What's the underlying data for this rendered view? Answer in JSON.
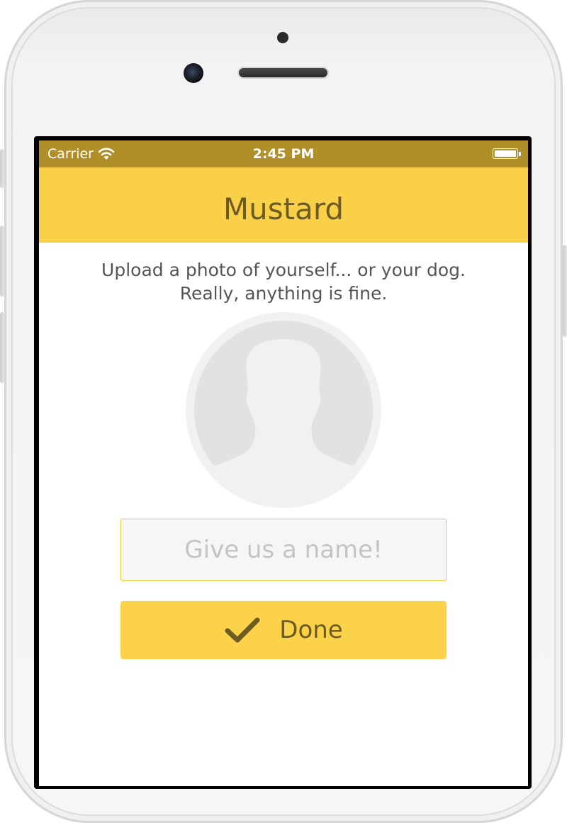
{
  "status_bar": {
    "carrier": "Carrier",
    "time": "2:45 PM",
    "wifi_icon": "wifi-icon",
    "battery_icon": "battery-icon",
    "battery_level": 1.0
  },
  "nav_bar": {
    "title": "Mustard"
  },
  "main": {
    "instructions": "Upload a photo of yourself... or your dog. Really, anything is fine.",
    "avatar_icon": "person-silhouette-icon",
    "name_field": {
      "placeholder": "Give us a name!",
      "value": ""
    },
    "done_button": {
      "label": "Done",
      "icon": "checkmark-icon"
    }
  },
  "colors": {
    "status_bar": "#b18f28",
    "nav_bar": "#f9d048",
    "title_text": "#6e5b22",
    "button": "#fbd24a",
    "field_border": "#f3c832"
  }
}
